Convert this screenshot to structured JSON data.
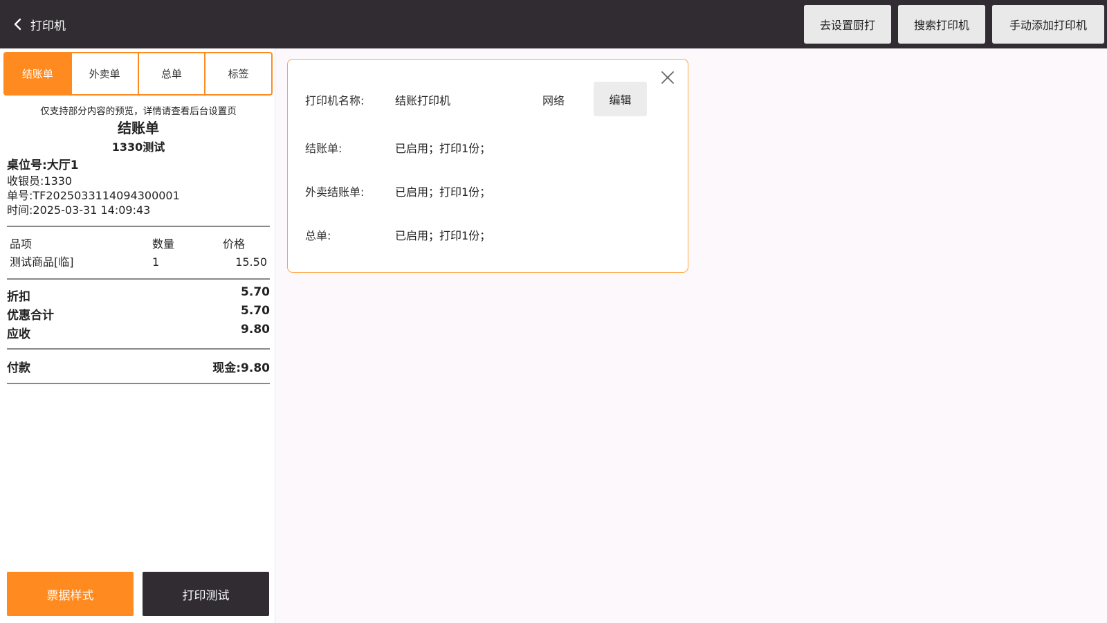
{
  "header": {
    "back_icon": "chevron-left-icon",
    "title": "打印机",
    "buttons": {
      "kitchen": "去设置厨打",
      "search": "搜索打印机",
      "manual_add": "手动添加打印机"
    }
  },
  "tabs": [
    {
      "label": "结账单",
      "active": true
    },
    {
      "label": "外卖单",
      "active": false
    },
    {
      "label": "总单",
      "active": false
    },
    {
      "label": "标签",
      "active": false
    }
  ],
  "receipt": {
    "notice": "仅支持部分内容的预览，详情请查看后台设置页",
    "title": "结账单",
    "shop": "1330测试",
    "table_no": "桌位号:大厅1",
    "cashier": "收银员:1330",
    "order_no": "单号:TF2025033114094300001",
    "time": "时间:2025-03-31 14:09:43",
    "columns": {
      "item": "品项",
      "qty": "数量",
      "price": "价格"
    },
    "items": [
      {
        "name": "测试商品[临]",
        "qty": "1",
        "price": "15.50"
      }
    ],
    "summary": {
      "discount_label": "折扣",
      "discount_value": "5.70",
      "promo_label": "优惠合计",
      "promo_value": "5.70",
      "due_label": "应收",
      "due_value": "9.80"
    },
    "payment": {
      "label": "付款",
      "value": "现金:9.80"
    }
  },
  "actions": {
    "style_button": "票据样式",
    "test_button": "打印测试"
  },
  "printer_card": {
    "close_icon": "close-icon",
    "name_label": "打印机名称:",
    "name_value": "结账打印机",
    "type": "网络",
    "edit_button": "编辑",
    "rows": [
      {
        "label": "结账单:",
        "value": "已启用；打印1份；"
      },
      {
        "label": "外卖结账单:",
        "value": "已启用；打印1份；"
      },
      {
        "label": "总单:",
        "value": "已启用；打印1份；"
      }
    ]
  },
  "colors": {
    "accent": "#ff8a1f",
    "topbar": "#302c32",
    "card_border": "#ffa53c"
  }
}
